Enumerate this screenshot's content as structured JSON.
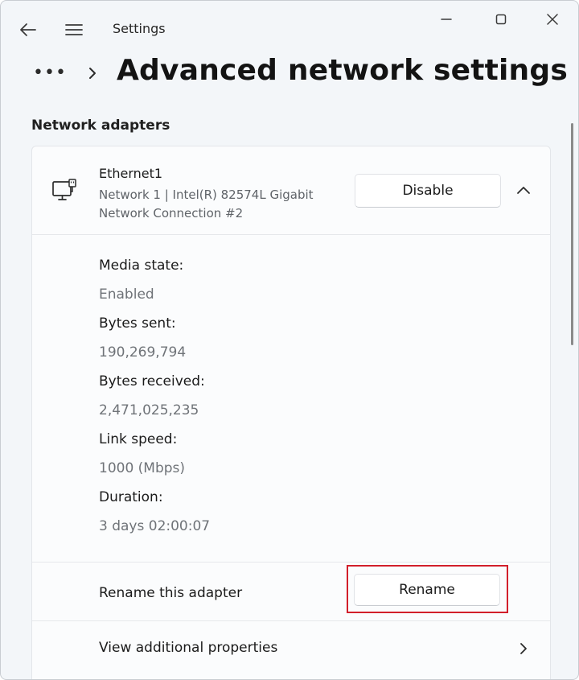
{
  "window": {
    "app_title": "Settings"
  },
  "header": {
    "more_label": "•••",
    "page_title": "Advanced network settings"
  },
  "section": {
    "heading": "Network adapters"
  },
  "adapter": {
    "name": "Ethernet1",
    "description": "Network 1 | Intel(R) 82574L Gigabit Network Connection #2",
    "disable_label": "Disable",
    "icon": "ethernet-monitor-icon",
    "expanded": true,
    "properties": [
      {
        "label": "Media state:",
        "value": "Enabled"
      },
      {
        "label": "Bytes sent:",
        "value": "190,269,794"
      },
      {
        "label": "Bytes received:",
        "value": "2,471,025,235"
      },
      {
        "label": "Link speed:",
        "value": "1000 (Mbps)"
      },
      {
        "label": "Duration:",
        "value": "3 days 02:00:07"
      }
    ],
    "rename": {
      "label": "Rename this adapter",
      "button_label": "Rename"
    },
    "view_properties": {
      "label": "View additional properties"
    }
  },
  "colors": {
    "highlight": "#d21f2b",
    "background": "#f3f6f9",
    "card": "#fbfcfd"
  }
}
